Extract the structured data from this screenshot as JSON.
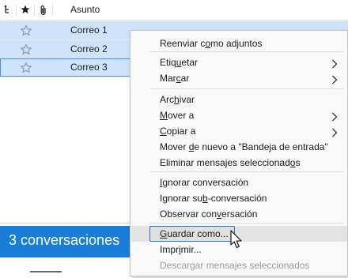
{
  "header": {
    "thread_icon": "thread-icon",
    "star_icon": "star-icon",
    "attachment_icon": "attachment-icon",
    "subject_label": "Asunto"
  },
  "rows": [
    {
      "subject": "Correo 1",
      "star_icon": "star-outline-icon"
    },
    {
      "subject": "Correo 2",
      "star_icon": "star-outline-icon"
    },
    {
      "subject": "Correo 3",
      "star_icon": "star-outline-icon"
    }
  ],
  "summary": {
    "banner_text": "3 conversaciones"
  },
  "context_menu": {
    "items": [
      {
        "label_pre": "Reenviar c",
        "accel": "o",
        "label_post": "mo adjuntos",
        "submenu": false,
        "disabled": false
      },
      {
        "label_pre": "Etiq",
        "accel": "u",
        "label_post": "etar",
        "submenu": true,
        "disabled": false
      },
      {
        "label_pre": "Mar",
        "accel": "c",
        "label_post": "ar",
        "submenu": true,
        "disabled": false
      },
      {
        "label_pre": "Arc",
        "accel": "h",
        "label_post": "ivar",
        "submenu": false,
        "disabled": false
      },
      {
        "label_pre": "",
        "accel": "M",
        "label_post": "over a",
        "submenu": true,
        "disabled": false
      },
      {
        "label_pre": "",
        "accel": "C",
        "label_post": "opiar a",
        "submenu": true,
        "disabled": false
      },
      {
        "label_pre": "Mover ",
        "accel": "d",
        "label_post": "e nuevo a \"Bandeja de entrada\"",
        "submenu": false,
        "disabled": false
      },
      {
        "label_pre": "Eliminar mensajes seleccionad",
        "accel": "o",
        "label_post": "s",
        "submenu": false,
        "disabled": false
      },
      {
        "label_pre": "",
        "accel": "I",
        "label_post": "gnorar conversación",
        "submenu": false,
        "disabled": false
      },
      {
        "label_pre": "Ignorar su",
        "accel": "b",
        "label_post": "-conversación",
        "submenu": false,
        "disabled": false
      },
      {
        "label_pre": "Observar con",
        "accel": "v",
        "label_post": "ersación",
        "submenu": false,
        "disabled": false
      },
      {
        "label_pre": "",
        "accel": "G",
        "label_post": "uardar como...",
        "submenu": false,
        "disabled": false,
        "hovered": true
      },
      {
        "label_pre": "Impr",
        "accel": "i",
        "label_post": "mir...",
        "submenu": false,
        "disabled": false
      },
      {
        "label_pre": "Descargar mensajes seleccionados",
        "accel": "",
        "label_post": "",
        "submenu": false,
        "disabled": true
      }
    ],
    "chevron_icon": "chevron-right-icon"
  },
  "cursor_icon": "mouse-pointer-icon",
  "colors": {
    "selection": "#cfe4fb",
    "banner": "#1a7ed8",
    "focus_outline": "#1f73d6"
  }
}
